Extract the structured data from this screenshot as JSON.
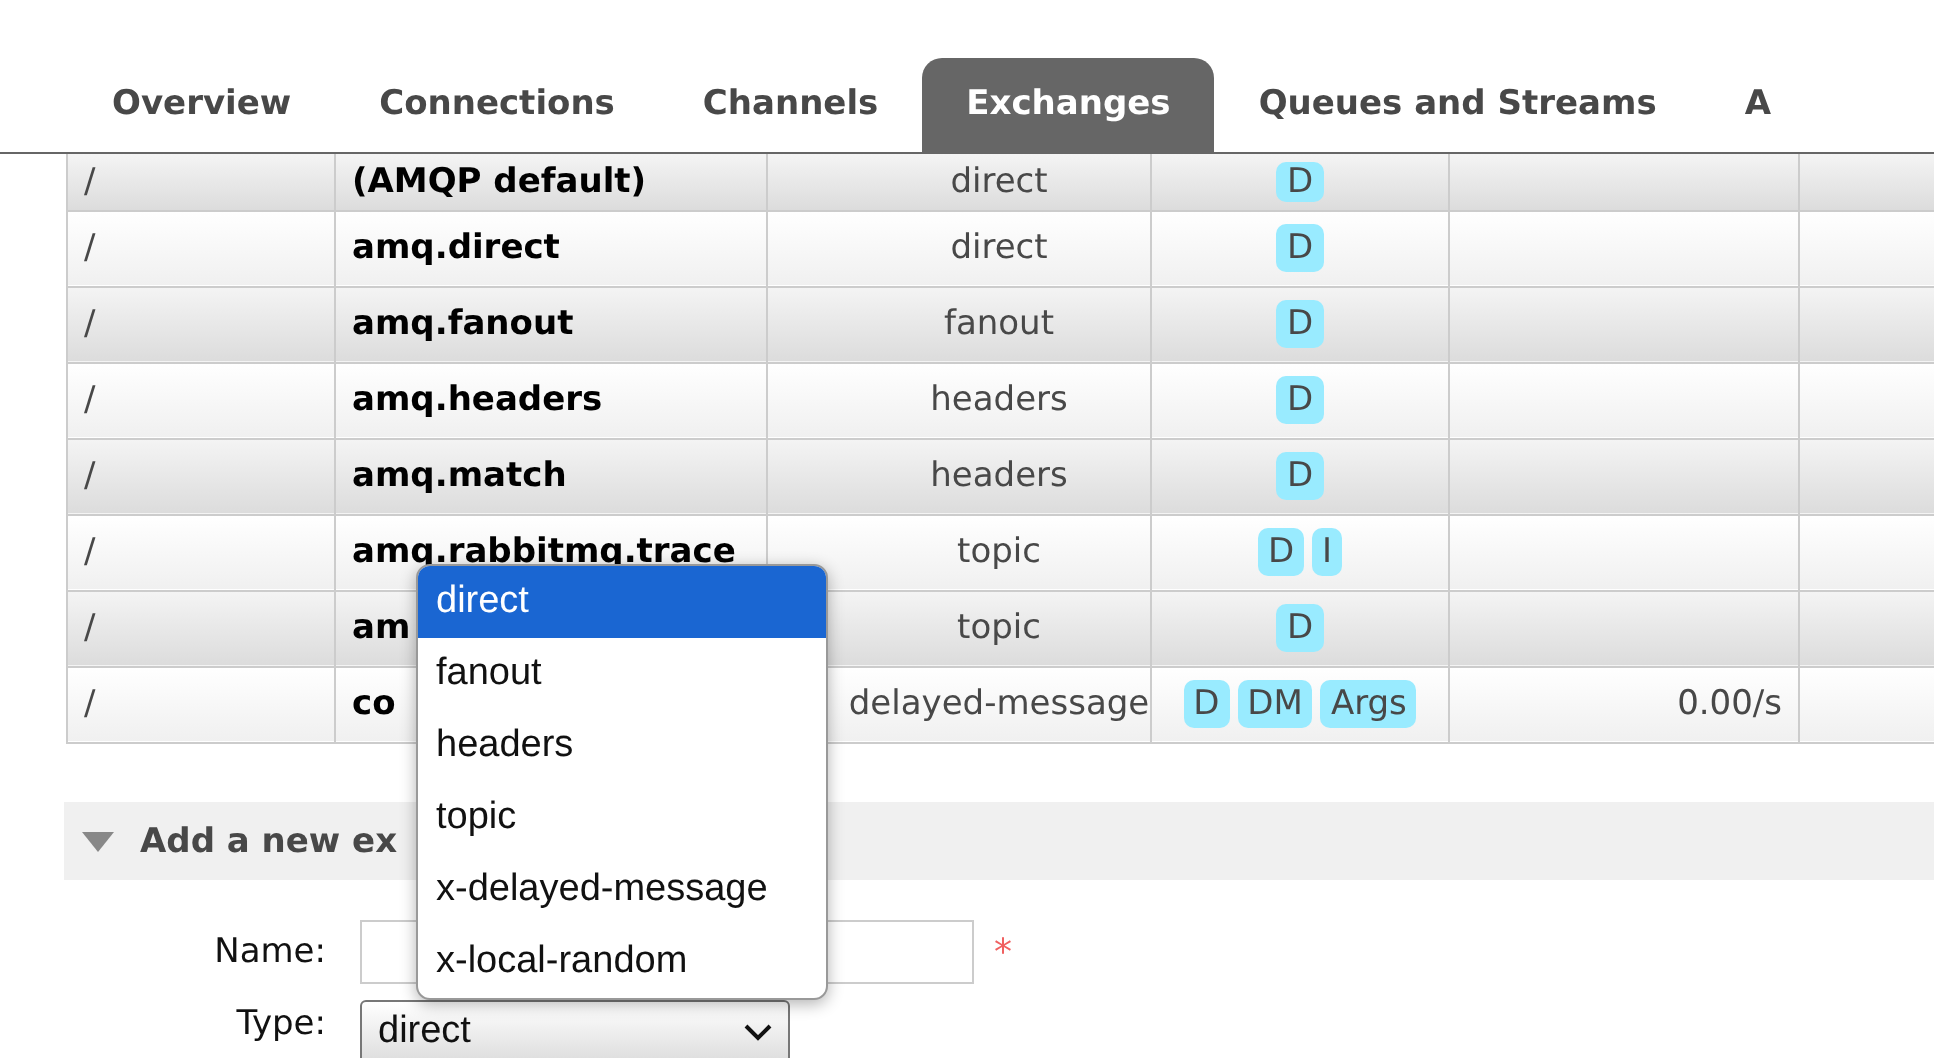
{
  "tabs": [
    {
      "label": "Overview",
      "selected": false
    },
    {
      "label": "Connections",
      "selected": false
    },
    {
      "label": "Channels",
      "selected": false
    },
    {
      "label": "Exchanges",
      "selected": true
    },
    {
      "label": "Queues and Streams",
      "selected": false
    },
    {
      "label": "A",
      "selected": false
    }
  ],
  "table": {
    "rows": [
      {
        "virtual_host": "/",
        "name": "(AMQP default)",
        "type": "direct",
        "features": [
          "D"
        ],
        "rate": ""
      },
      {
        "virtual_host": "/",
        "name": "amq.direct",
        "type": "direct",
        "features": [
          "D"
        ],
        "rate": ""
      },
      {
        "virtual_host": "/",
        "name": "amq.fanout",
        "type": "fanout",
        "features": [
          "D"
        ],
        "rate": ""
      },
      {
        "virtual_host": "/",
        "name": "amq.headers",
        "type": "headers",
        "features": [
          "D"
        ],
        "rate": ""
      },
      {
        "virtual_host": "/",
        "name": "amq.match",
        "type": "headers",
        "features": [
          "D"
        ],
        "rate": ""
      },
      {
        "virtual_host": "/",
        "name": "amq.rabbitmq.trace",
        "type": "topic",
        "features": [
          "D",
          "I"
        ],
        "rate": ""
      },
      {
        "virtual_host": "/",
        "name": "am",
        "type": "topic",
        "features": [
          "D"
        ],
        "rate": ""
      },
      {
        "virtual_host": "/",
        "name": "co",
        "type": "delayed-message",
        "features": [
          "D",
          "DM",
          "Args"
        ],
        "rate": "0.00/s"
      }
    ]
  },
  "add_section": {
    "title": "Add a new ex",
    "expanded": true,
    "fields": [
      {
        "kind": "text",
        "label": "Name:",
        "required": true,
        "required_mark": "*"
      },
      {
        "kind": "select",
        "label": "Type:",
        "value": "direct"
      }
    ]
  },
  "type_dropdown": {
    "options": [
      {
        "label": "direct",
        "selected": true
      },
      {
        "label": "fanout",
        "selected": false
      },
      {
        "label": "headers",
        "selected": false
      },
      {
        "label": "topic",
        "selected": false
      },
      {
        "label": "x-delayed-message",
        "selected": false
      },
      {
        "label": "x-local-random",
        "selected": false
      }
    ]
  }
}
